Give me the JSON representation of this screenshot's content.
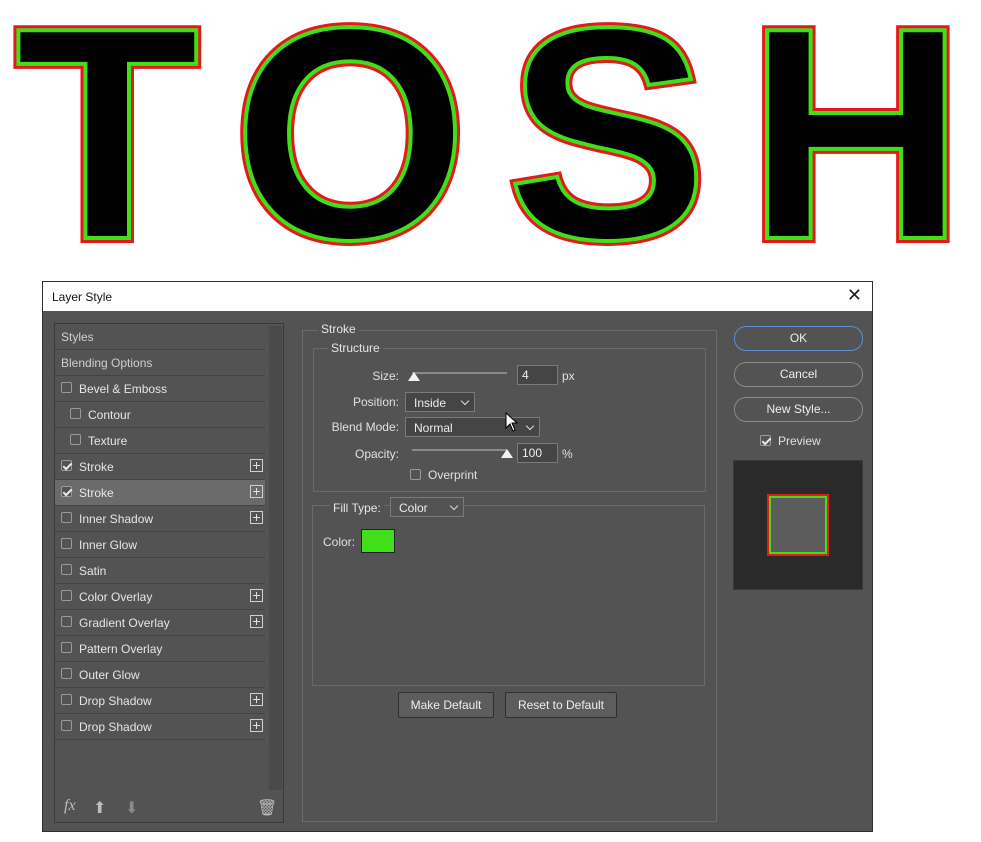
{
  "canvas": {
    "text": "TOSH",
    "fill_color": "#000000",
    "outer_stroke_color": "#e21a1a",
    "inner_stroke_color": "#3fe01a"
  },
  "dialog": {
    "title": "Layer Style",
    "close_icon": "close-icon",
    "styles_list": [
      {
        "label": "Styles",
        "type": "header"
      },
      {
        "label": "Blending Options",
        "type": "header"
      },
      {
        "label": "Bevel & Emboss",
        "checked": false,
        "has_plus": false
      },
      {
        "label": "Contour",
        "checked": false,
        "indent": true
      },
      {
        "label": "Texture",
        "checked": false,
        "indent": true
      },
      {
        "label": "Stroke",
        "checked": true,
        "has_plus": true
      },
      {
        "label": "Stroke",
        "checked": true,
        "has_plus": true,
        "selected": true
      },
      {
        "label": "Inner Shadow",
        "checked": false,
        "has_plus": true
      },
      {
        "label": "Inner Glow",
        "checked": false
      },
      {
        "label": "Satin",
        "checked": false
      },
      {
        "label": "Color Overlay",
        "checked": false,
        "has_plus": true
      },
      {
        "label": "Gradient Overlay",
        "checked": false,
        "has_plus": true
      },
      {
        "label": "Pattern Overlay",
        "checked": false
      },
      {
        "label": "Outer Glow",
        "checked": false
      },
      {
        "label": "Drop Shadow",
        "checked": false,
        "has_plus": true
      },
      {
        "label": "Drop Shadow",
        "checked": false,
        "has_plus": true
      }
    ],
    "bottom_icons": [
      "fx-icon",
      "arrow-up-icon",
      "arrow-down-icon",
      "trash-icon"
    ],
    "fx_label": "fx",
    "stroke": {
      "group_label": "Stroke",
      "structure_label": "Structure",
      "size_label": "Size:",
      "size_value": "4",
      "size_unit": "px",
      "size_slider_fraction": 0.02,
      "position_label": "Position:",
      "position_value": "Inside",
      "blend_mode_label": "Blend Mode:",
      "blend_mode_value": "Normal",
      "opacity_label": "Opacity:",
      "opacity_value": "100",
      "opacity_unit": "%",
      "opacity_slider_fraction": 1.0,
      "overprint_label": "Overprint",
      "overprint_checked": false,
      "fill_type_label": "Fill Type:",
      "fill_type_value": "Color",
      "color_label": "Color:",
      "color_value": "#3fe01a",
      "make_default_label": "Make Default",
      "reset_default_label": "Reset to Default"
    },
    "buttons": {
      "ok": "OK",
      "cancel": "Cancel",
      "new_style": "New Style..."
    },
    "preview": {
      "label": "Preview",
      "checked": true
    }
  }
}
